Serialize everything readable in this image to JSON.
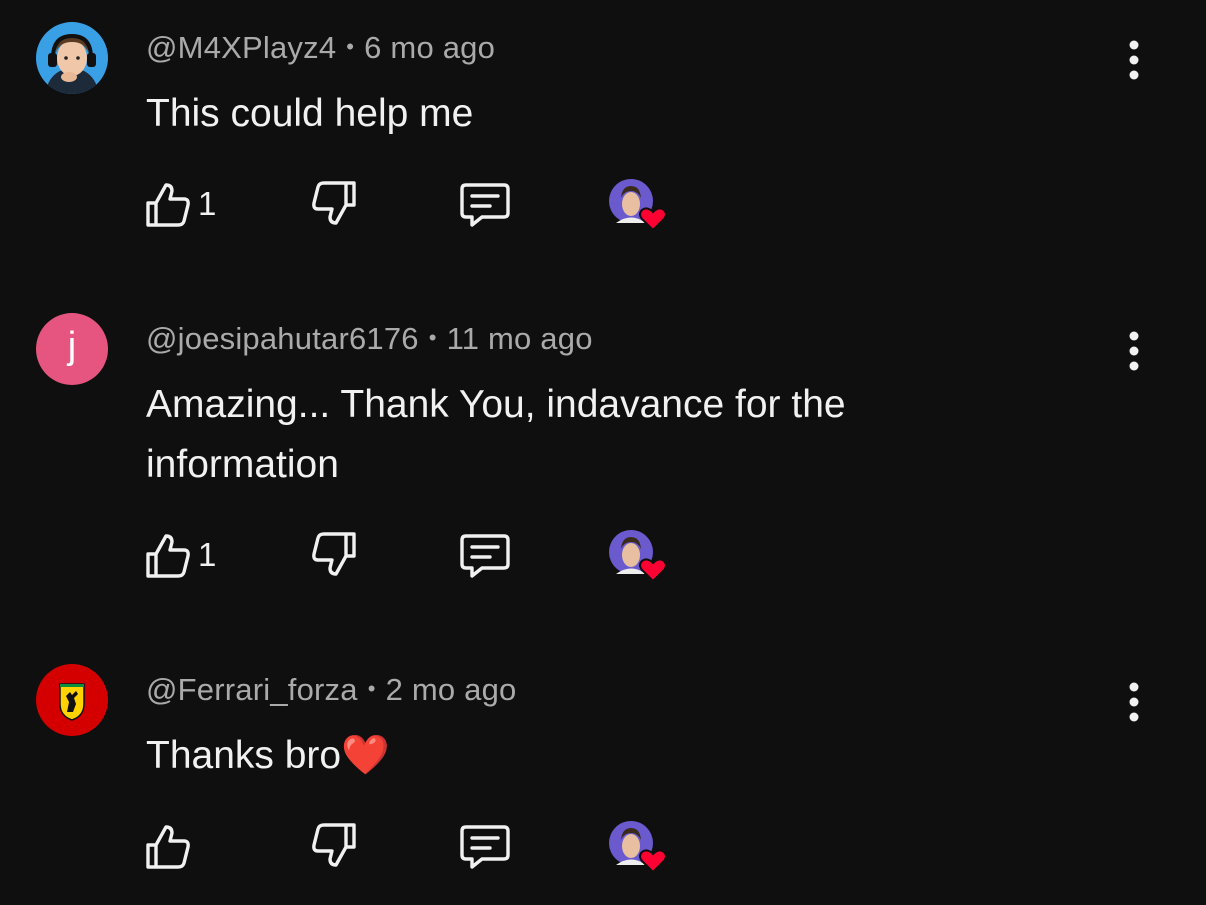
{
  "comments": [
    {
      "author": "@M4XPlayz4",
      "time": "6 mo ago",
      "text": "This could help me",
      "likes": "1",
      "avatar_icon": "gamer-headset-avatar"
    },
    {
      "author": "@joesipahutar6176",
      "time": "11 mo ago",
      "text": "Amazing... Thank You, indavance for the information",
      "likes": "1",
      "avatar_letter": "j",
      "avatar_color": "#e5557f"
    },
    {
      "author": "@Ferrari_forza",
      "time": "2 mo ago",
      "text": "Thanks bro❤️",
      "likes": "",
      "avatar_icon": "ferrari-logo-avatar",
      "avatar_color": "#d40000"
    }
  ],
  "separator": "•",
  "colors": {
    "background": "#0f0f0f",
    "meta_text": "#aaaaaa",
    "heart": "#ff0033",
    "creator_avatar_bg": "#6a5acd"
  }
}
